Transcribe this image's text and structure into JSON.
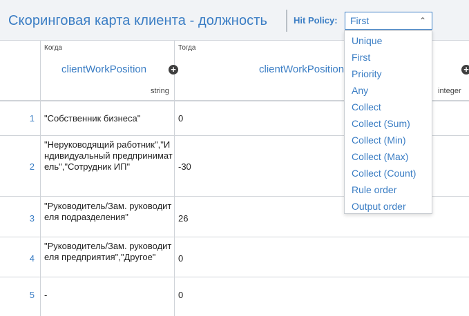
{
  "header": {
    "title": "Скоринговая карта клиента - должность",
    "hit_policy_label": "Hit Policy:",
    "hit_policy_value": "First"
  },
  "columns": {
    "when": {
      "caption": "Когда",
      "name": "clientWorkPosition",
      "type": "string"
    },
    "then": {
      "caption": "Тогда",
      "name": "clientWorkPosition",
      "type": "integer"
    }
  },
  "rows": [
    {
      "num": "1",
      "when": "\"Собственник бизнеса\"",
      "then": "0"
    },
    {
      "num": "2",
      "when": "\"Неруководящий работник\",\"Индивидуальный предприниматель\",\"Сотрудник ИП\"",
      "then": "-30"
    },
    {
      "num": "3",
      "when": "\"Руководитель/Зам. руководителя подразделения\"",
      "then": "26"
    },
    {
      "num": "4",
      "when": "\"Руководитель/Зам. руководителя предприятия\",\"Другое\"",
      "then": "0"
    },
    {
      "num": "5",
      "when": "-",
      "then": "0"
    }
  ],
  "hit_policy_options": [
    "Unique",
    "First",
    "Priority",
    "Any",
    "Collect",
    "Collect (Sum)",
    "Collect (Min)",
    "Collect (Max)",
    "Collect (Count)",
    "Rule order",
    "Output order"
  ],
  "icons": {
    "add_column": "plus-circle-icon",
    "select_chevron": "chevron-up-icon"
  },
  "colors": {
    "accent": "#3a7dc4",
    "header_bg": "#f1f3f6",
    "grid_line": "#cfd3d8"
  }
}
